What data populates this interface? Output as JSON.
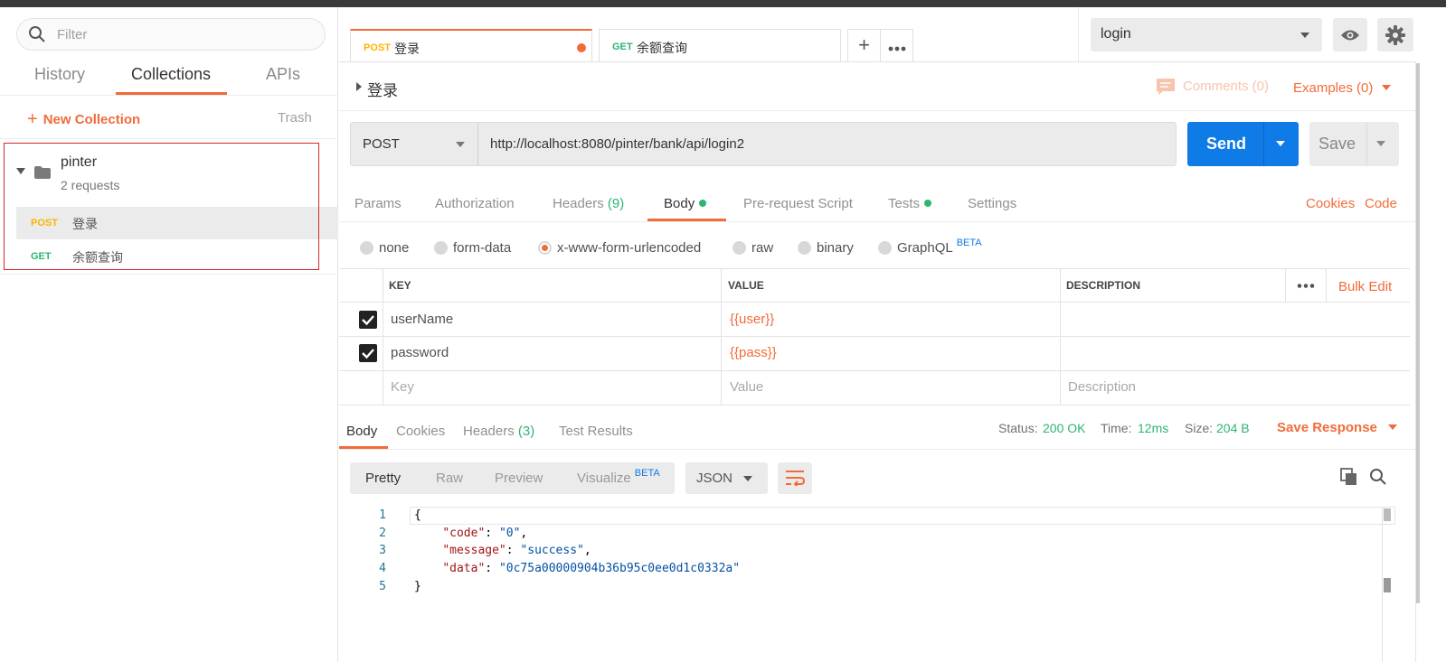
{
  "sidebar": {
    "filter_placeholder": "Filter",
    "tabs": [
      {
        "label": "History"
      },
      {
        "label": "Collections"
      },
      {
        "label": "APIs"
      }
    ],
    "new_collection_label": "New Collection",
    "trash_label": "Trash",
    "collection": {
      "name": "pinter",
      "count_text": "2 requests",
      "requests": [
        {
          "method": "POST",
          "name": "登录"
        },
        {
          "method": "GET",
          "name": "余额查询"
        }
      ]
    }
  },
  "tabs": [
    {
      "method": "POST",
      "name": "登录"
    },
    {
      "method": "GET",
      "name": "余额查询"
    }
  ],
  "environment": {
    "selected": "login"
  },
  "request": {
    "title": "登录",
    "comments_label": "Comments (0)",
    "examples_label": "Examples (0)",
    "method": "POST",
    "url": "http://localhost:8080/pinter/bank/api/login2",
    "send_label": "Send",
    "save_label": "Save",
    "tabs": {
      "params": "Params",
      "authorization": "Authorization",
      "headers": "Headers",
      "headers_count": "(9)",
      "body": "Body",
      "prerequest": "Pre-request Script",
      "tests": "Tests",
      "settings": "Settings"
    },
    "cookies_link": "Cookies",
    "code_link": "Code",
    "body_types": {
      "none": "none",
      "form_data": "form-data",
      "urlencoded": "x-www-form-urlencoded",
      "raw": "raw",
      "binary": "binary",
      "graphql": "GraphQL",
      "beta": "BETA"
    },
    "table": {
      "headers": {
        "key": "KEY",
        "value": "VALUE",
        "description": "DESCRIPTION"
      },
      "bulk_edit": "Bulk Edit",
      "rows": [
        {
          "key": "userName",
          "value": "{{user}}"
        },
        {
          "key": "password",
          "value": "{{pass}}"
        }
      ],
      "placeholders": {
        "key": "Key",
        "value": "Value",
        "description": "Description"
      }
    }
  },
  "response": {
    "tabs": {
      "body": "Body",
      "cookies": "Cookies",
      "headers": "Headers",
      "headers_count": "(3)",
      "tests": "Test Results"
    },
    "status_label": "Status:",
    "status_value": "200 OK",
    "time_label": "Time:",
    "time_value": "12ms",
    "size_label": "Size:",
    "size_value": "204 B",
    "save_response": "Save Response",
    "views": {
      "pretty": "Pretty",
      "raw": "Raw",
      "preview": "Preview",
      "visualize": "Visualize",
      "beta": "BETA"
    },
    "format": "JSON",
    "line_numbers": [
      "1",
      "2",
      "3",
      "4",
      "5"
    ],
    "json": {
      "open": "{",
      "code_key": "\"code\"",
      "code_val": "\"0\"",
      "message_key": "\"message\"",
      "message_val": "\"success\"",
      "data_key": "\"data\"",
      "data_val": "\"0c75a00000904b36b95c0ee0d1c0332a\"",
      "close": "}"
    }
  }
}
